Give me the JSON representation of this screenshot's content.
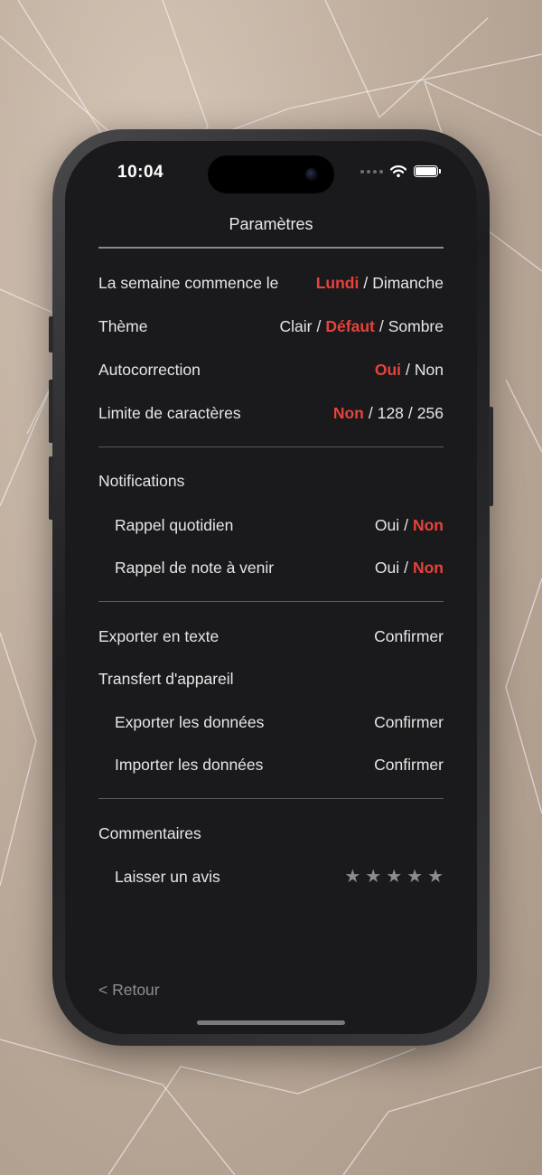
{
  "status_bar": {
    "time": "10:04"
  },
  "header": {
    "title": "Paramètres"
  },
  "general": {
    "week_start": {
      "label": "La semaine commence le",
      "options": [
        "Lundi",
        "Dimanche"
      ],
      "selected": "Lundi"
    },
    "theme": {
      "label": "Thème",
      "options": [
        "Clair",
        "Défaut",
        "Sombre"
      ],
      "selected": "Défaut"
    },
    "autocorrect": {
      "label": "Autocorrection",
      "options": [
        "Oui",
        "Non"
      ],
      "selected": "Oui"
    },
    "char_limit": {
      "label": "Limite de caractères",
      "options": [
        "Non",
        "128",
        "256"
      ],
      "selected": "Non"
    }
  },
  "notifications": {
    "heading": "Notifications",
    "daily": {
      "label": "Rappel quotidien",
      "options": [
        "Oui",
        "Non"
      ],
      "selected": "Non"
    },
    "upcoming": {
      "label": "Rappel de note à venir",
      "options": [
        "Oui",
        "Non"
      ],
      "selected": "Non"
    }
  },
  "data": {
    "export_text": {
      "label": "Exporter en texte",
      "action": "Confirmer"
    },
    "transfer_heading": "Transfert d'appareil",
    "export_data": {
      "label": "Exporter les données",
      "action": "Confirmer"
    },
    "import_data": {
      "label": "Importer les données",
      "action": "Confirmer"
    }
  },
  "feedback": {
    "heading": "Commentaires",
    "review": {
      "label": "Laisser un avis",
      "stars": [
        "★",
        "★",
        "★",
        "★",
        "★"
      ],
      "rating": 0
    }
  },
  "footer": {
    "back_label": "< Retour"
  },
  "colors": {
    "accent": "#e8423c",
    "background": "#1a1a1c",
    "text": "#e6e6e6",
    "muted": "#8e8e90"
  }
}
